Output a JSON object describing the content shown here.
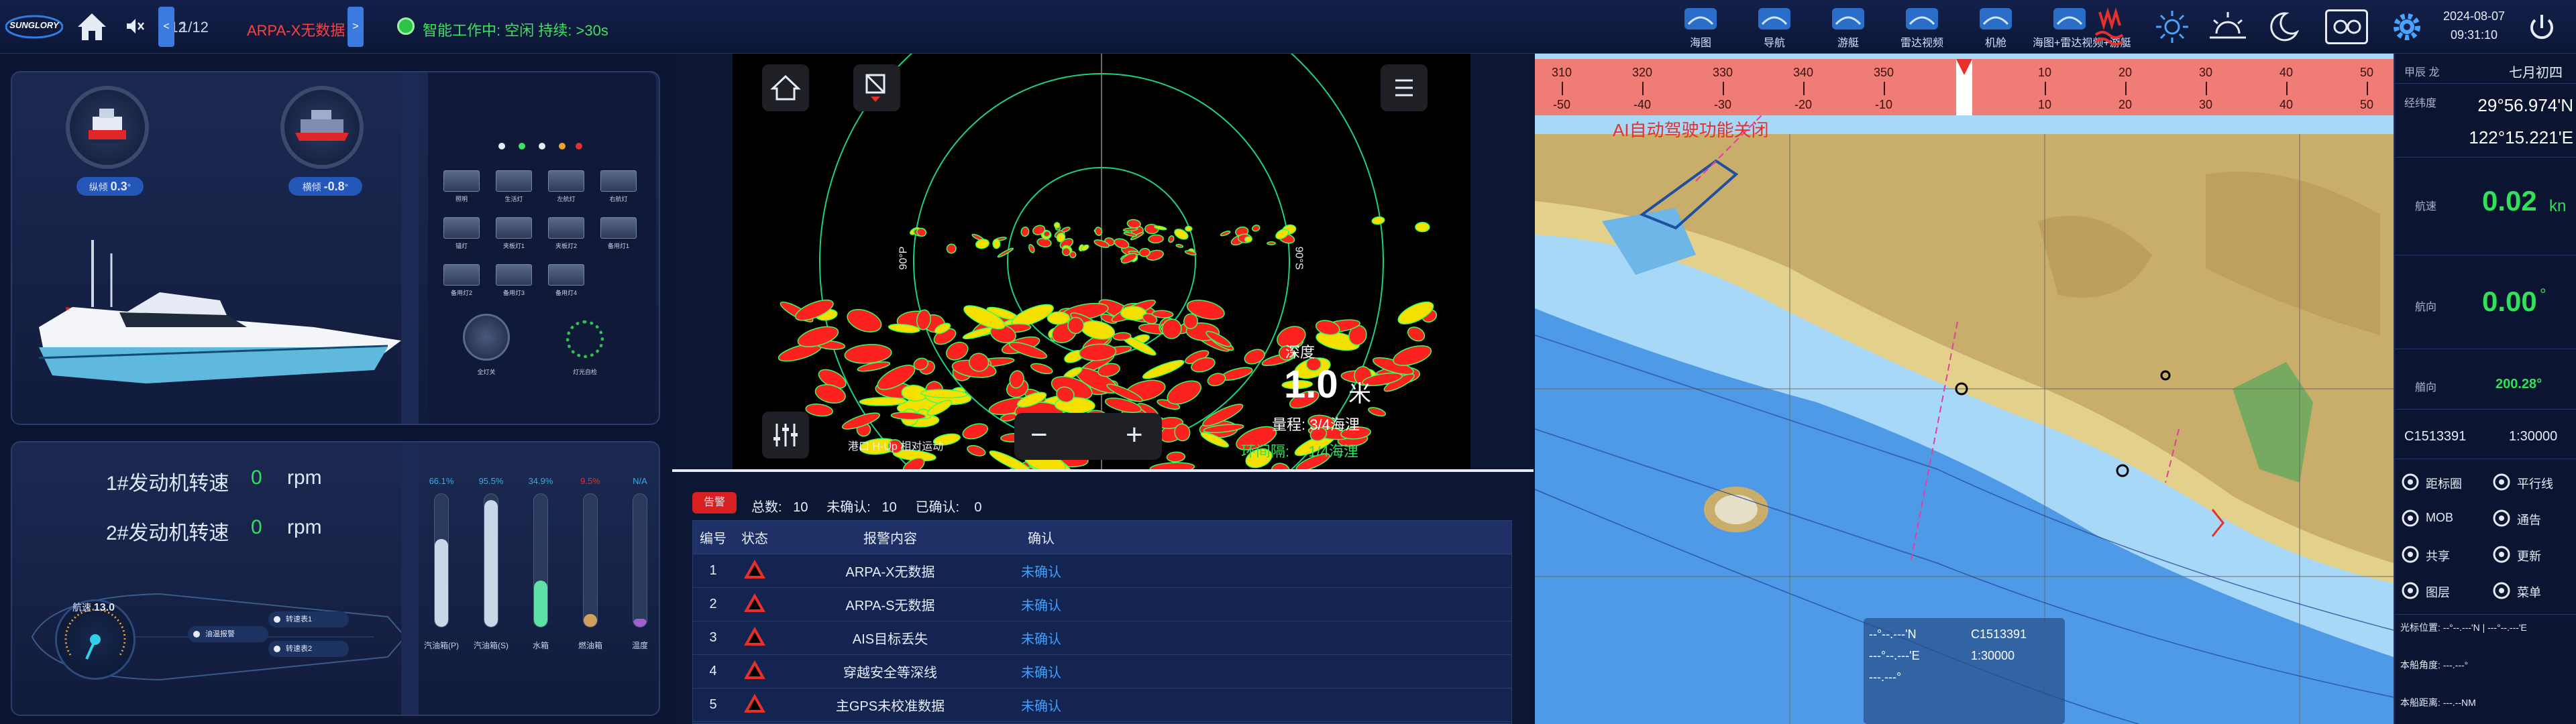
{
  "topbar": {
    "brand": "SUNGLORY",
    "page_counter": "1/12",
    "arpa_alert": "ARPA-X无数据",
    "prev_label": "<",
    "next_label": ">",
    "status_text": "智能工作中: 空闲 持续: >30s",
    "date": "2024-08-07",
    "time": "09:31:10",
    "apps": [
      {
        "label": "海图",
        "icon": "chart-icon"
      },
      {
        "label": "导航",
        "icon": "navigation-icon"
      },
      {
        "label": "游艇",
        "icon": "yacht-icon"
      },
      {
        "label": "雷达视频",
        "icon": "radar-video-icon"
      },
      {
        "label": "机舱",
        "icon": "engine-room-icon"
      },
      {
        "label": "海图+雷达视频+游艇",
        "icon": "combined-view-icon"
      }
    ]
  },
  "vessel": {
    "pitch_label": "纵倾",
    "pitch_value": "0.3",
    "roll_label": "横倾",
    "roll_value": "-0.8",
    "deg": "°"
  },
  "switches": {
    "items": [
      "照明",
      "生活灯",
      "左航灯",
      "右航灯",
      "锚灯",
      "夹板灯1",
      "夹板灯2",
      "备用灯1",
      "备用灯2",
      "备用灯3",
      "备用灯4"
    ],
    "all_off": "全灯关",
    "indicator": "灯光自检"
  },
  "engines": {
    "engine1_label": "1#发动机转速",
    "engine1_value": "0",
    "engine2_label": "2#发动机转速",
    "engine2_value": "0",
    "unit": "rpm",
    "speed_label": "航速",
    "speed_value": "13.0",
    "tanks": [
      {
        "pct": "66.1%",
        "fill": 0.661,
        "label": "汽油箱(P)",
        "color": "#c9d7e8"
      },
      {
        "pct": "95.5%",
        "fill": 0.955,
        "label": "汽油箱(S)",
        "color": "#c9d7e8"
      },
      {
        "pct": "34.9%",
        "fill": 0.349,
        "label": "水箱",
        "color": "#5fe0a6"
      },
      {
        "pct": "9.5%",
        "fill": 0.095,
        "label": "燃油箱",
        "color": "#d0a060"
      },
      {
        "pct": "N/A",
        "fill": 0.06,
        "label": "温度",
        "color": "#a060d0"
      }
    ],
    "chips": [
      "油温报警",
      "转速表1",
      "转速表2"
    ]
  },
  "radar": {
    "depth_label": "深度",
    "depth_value": "1.0",
    "depth_unit": "米",
    "range_label": "量程:",
    "range_value": "3/4海浬",
    "ring_label": "环间隔:",
    "ring_value": "1/4海浬",
    "mode_text": "港口  H-Up  相对运动",
    "bearing_left": "90°P",
    "bearing_right": "90°S"
  },
  "alarms": {
    "button": "告警",
    "total_label": "总数:",
    "total": "10",
    "unack_label": "未确认:",
    "unack": "10",
    "ack_label": "已确认:",
    "ack": "0",
    "headers": [
      "编号",
      "状态",
      "报警内容",
      "确认"
    ],
    "rows": [
      {
        "no": "1",
        "content": "ARPA-X无数据",
        "ack": "未确认"
      },
      {
        "no": "2",
        "content": "ARPA-S无数据",
        "ack": "未确认"
      },
      {
        "no": "3",
        "content": "AIS目标丢失",
        "ack": "未确认"
      },
      {
        "no": "4",
        "content": "穿越安全等深线",
        "ack": "未确认"
      },
      {
        "no": "5",
        "content": "主GPS未校准数据",
        "ack": "未确认"
      }
    ]
  },
  "chart": {
    "compass": [
      "310",
      "320",
      "330",
      "340",
      "350",
      "",
      "10",
      "20",
      "30",
      "40",
      "50"
    ],
    "compass_offsets": [
      "-50",
      "-40",
      "-30",
      "-20",
      "-10",
      "",
      "10",
      "20",
      "30",
      "40",
      "50"
    ],
    "warning": "AI自动驾驶功能关闭",
    "info_lat": "--°--.---'N",
    "info_lon": "---°--.---'E",
    "info_misc": "---.---°",
    "info_chart": "C1513391",
    "info_scale": "1:30000"
  },
  "sidebar": {
    "date_label": "甲辰 龙",
    "lunar": "七月初四",
    "pos_label": "经纬度",
    "lat": "29°56.974'N",
    "lon": "122°15.221'E",
    "sog_label": "航速",
    "sog": "0.02",
    "sog_unit": "kn",
    "cog_label": "航向",
    "cog": "0.00",
    "cog_unit": "°",
    "hdg_label": "艏向",
    "hdg": "200.28°",
    "chart_id": "C1513391",
    "scale": "1:30000",
    "buttons": [
      [
        "距标圈",
        "平行线"
      ],
      [
        "MOB",
        "通告"
      ],
      [
        "共享",
        "更新"
      ],
      [
        "图层",
        "菜单"
      ]
    ],
    "cursor_label": "光标位置:",
    "cursor_value": "--°--.---'N | ---°--.---'E",
    "bearing_label": "本船角度:",
    "bearing_value": "---.---°",
    "distance_label": "本船距离:",
    "distance_value": "---.--NM"
  },
  "colors": {
    "accent": "#2f7de1",
    "green": "#2ee35a",
    "red": "#e8302a",
    "land": "#c9ad6a",
    "shallow": "#9fd0f5",
    "deep": "#3f8fe0"
  }
}
